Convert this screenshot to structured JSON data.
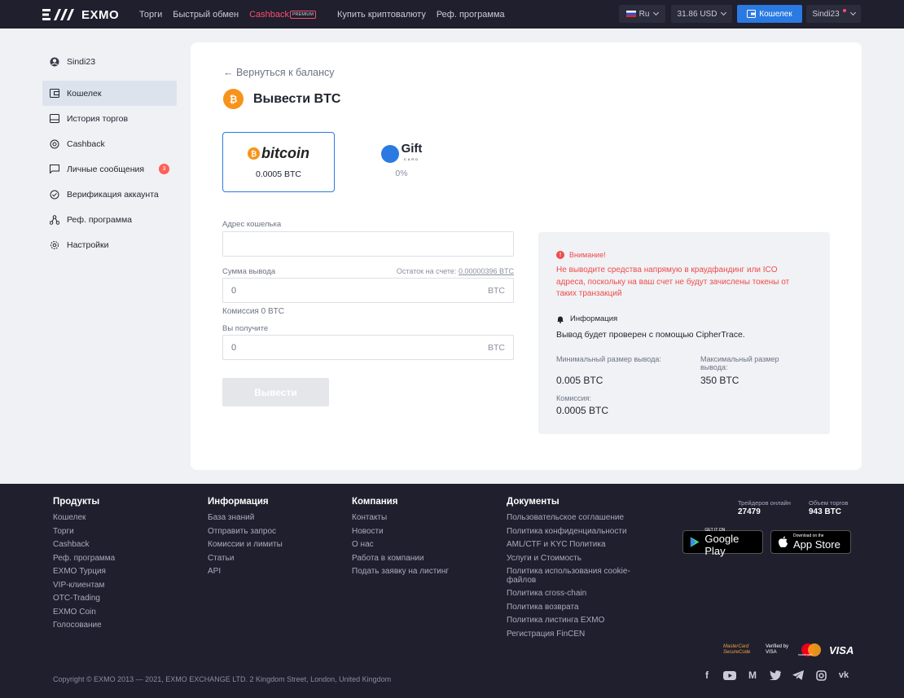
{
  "header": {
    "logo_text": "EXMO",
    "nav": [
      {
        "label": "Торги"
      },
      {
        "label": "Быстрый обмен"
      },
      {
        "label": "Cashback",
        "badge": "PREMIUM"
      },
      {
        "label": "Купить криптовалюту"
      },
      {
        "label": "Реф. программа"
      }
    ],
    "language": "Ru",
    "balance": "31.86 USD",
    "wallet_button": "Кошелек",
    "username": "Sindi23"
  },
  "sidebar": {
    "user": "Sindi23",
    "items": [
      {
        "label": "Кошелек",
        "icon": "wallet-icon",
        "active": true
      },
      {
        "label": "История торгов",
        "icon": "history-icon"
      },
      {
        "label": "Cashback",
        "icon": "cashback-icon"
      },
      {
        "label": "Личные сообщения",
        "icon": "message-icon",
        "badge": "3"
      },
      {
        "label": "Верификация аккаунта",
        "icon": "check-circle-icon"
      },
      {
        "label": "Реф. программа",
        "icon": "referral-icon"
      },
      {
        "label": "Настройки",
        "icon": "gear-icon"
      }
    ]
  },
  "main": {
    "back_link": "← Вернуться к балансу",
    "title": "Вывести BTC",
    "methods": [
      {
        "name": "bitcoin",
        "fee": "0.0005 BTC",
        "selected": true
      },
      {
        "name": "Gift",
        "sub": "CARD",
        "fee": "0%"
      }
    ],
    "address_label": "Адрес кошелька",
    "address_value": "",
    "amount_label": "Сумма вывода",
    "balance_label": "Остаток на счете:",
    "balance_value": "0.00000396 BTC",
    "amount_value": "0",
    "amount_unit": "BTC",
    "commission": "Комиссия 0 BTC",
    "receive_label": "Вы получите",
    "receive_value": "0",
    "receive_unit": "BTC",
    "submit": "Вывести"
  },
  "info": {
    "warning_title": "Внимание!",
    "warning_text": "Не выводите средства напрямую в краудфандинг или ICO адреса, поскольку на ваш счет не будут зачислены токены от таких транзакций",
    "info_title": "Информация",
    "info_text": "Вывод будет проверен с помощью CipherTrace.",
    "min_label": "Минимальный размер вывода:",
    "min_value": "0.005 BTC",
    "max_label": "Максимальный размер вывода:",
    "max_value": "350 BTC",
    "fee_label": "Комиссия:",
    "fee_value": "0.0005 BTC"
  },
  "footer": {
    "columns": [
      {
        "title": "Продукты",
        "links": [
          "Кошелек",
          "Торги",
          "Cashback",
          "Реф. программа",
          "EXMO Турция",
          "VIP-клиентам",
          "OTC-Trading",
          "EXMO Coin",
          "Голосование"
        ]
      },
      {
        "title": "Информация",
        "links": [
          "База знаний",
          "Отправить запрос",
          "Комиссии и лимиты",
          "Статьи",
          "API"
        ]
      },
      {
        "title": "Компания",
        "links": [
          "Контакты",
          "Новости",
          "О нас",
          "Работа в компании",
          "Подать заявку на листинг"
        ]
      },
      {
        "title": "Документы",
        "links": [
          "Пользовательское соглашение",
          "Политика конфиденциальности",
          "AML/CTF и KYC Политика",
          "Услуги и Стоимость",
          "Политика использования cookie-файлов",
          "Политика cross-chain",
          "Политика возврата",
          "Политика листинга EXMO",
          "Регистрация FinCEN"
        ]
      }
    ],
    "traders_label": "Трейдеров онлайн",
    "traders_value": "27479",
    "volume_label": "Объем торгов",
    "volume_value": "943 BTC",
    "google_small": "GET IT ON",
    "google_big": "Google Play",
    "apple_small": "Download on the",
    "apple_big": "App Store",
    "copyright": "Copyright © EXMO 2013 — 2021, EXMO EXCHANGE LTD. 2 Kingdom Street, London, United Kingdom",
    "payments": [
      "MasterCard SecureCode",
      "Verified by VISA",
      "mastercard",
      "VISA"
    ]
  }
}
